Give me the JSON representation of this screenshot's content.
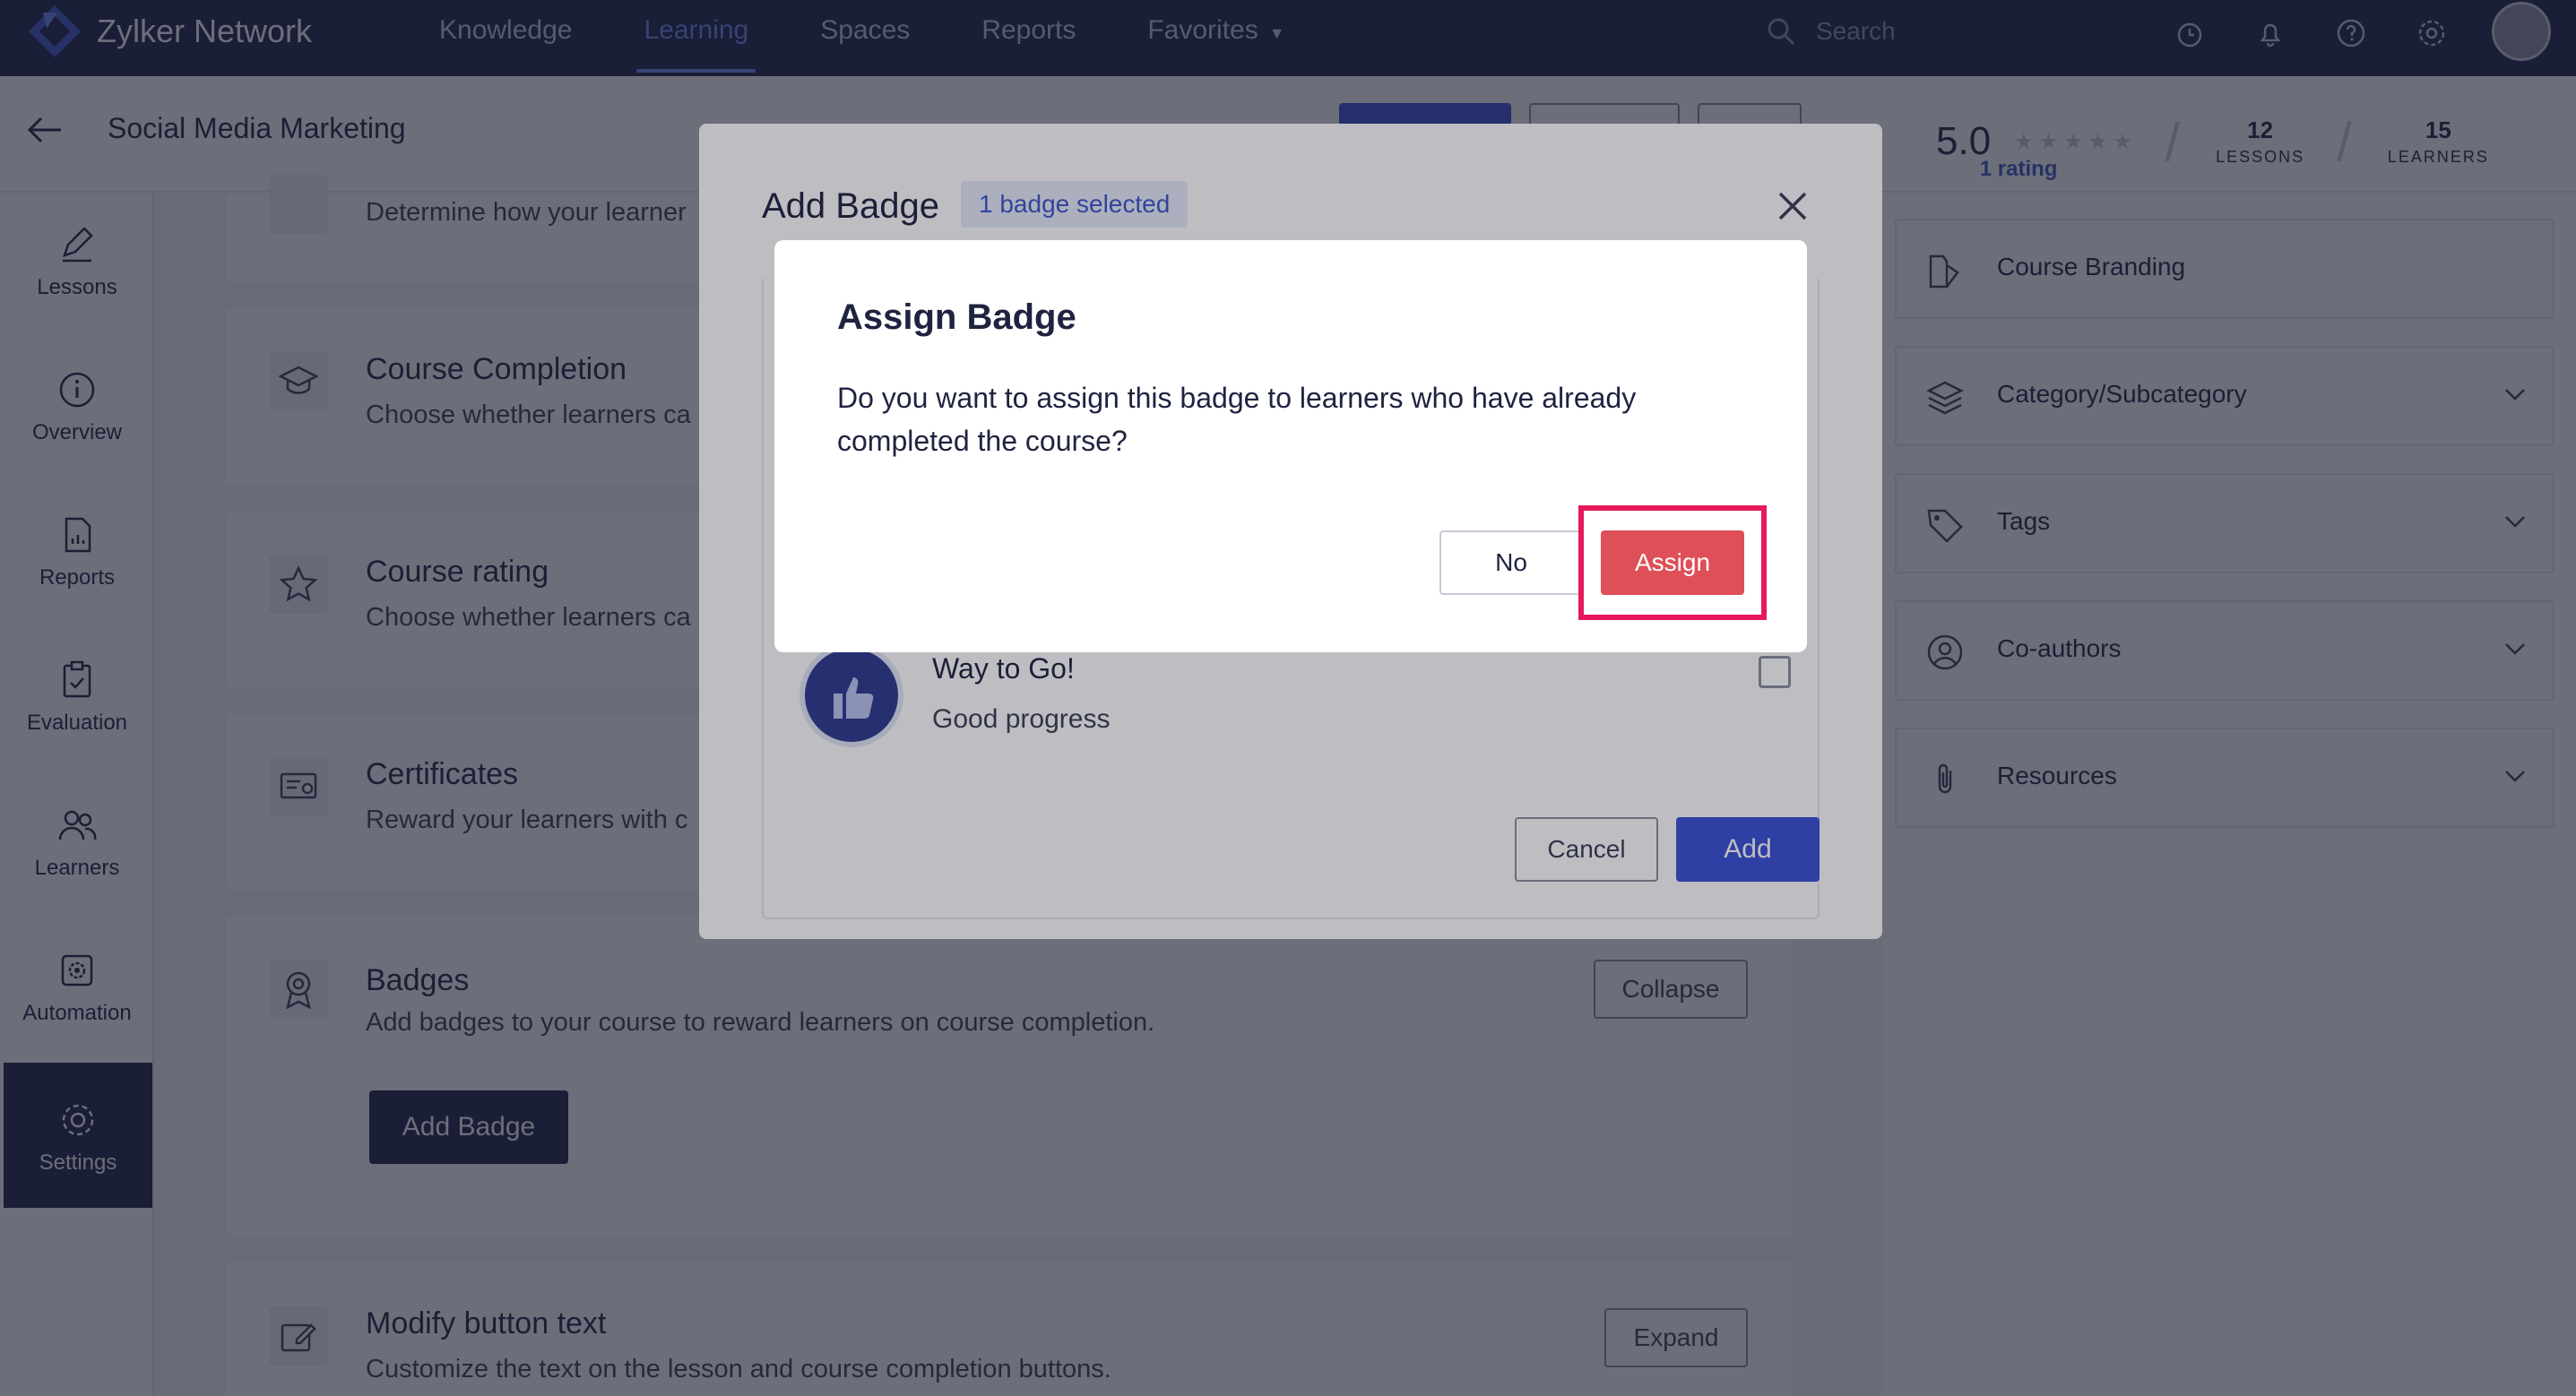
{
  "app": {
    "name": "Zylker Network"
  },
  "nav": {
    "links": [
      "Knowledge",
      "Learning",
      "Spaces",
      "Reports",
      "Favorites"
    ],
    "active": "Learning"
  },
  "search": {
    "placeholder": "Search"
  },
  "course": {
    "title": "Social Media Marketing",
    "rating_value": "5.0",
    "rating_count": "1 rating",
    "lessons_count": "12",
    "lessons_label": "LESSONS",
    "learners_count": "15",
    "learners_label": "LEARNERS"
  },
  "sidebar": {
    "items": [
      {
        "label": "Lessons",
        "icon": "pencil-icon"
      },
      {
        "label": "Overview",
        "icon": "info-icon"
      },
      {
        "label": "Reports",
        "icon": "report-icon"
      },
      {
        "label": "Evaluation",
        "icon": "clipboard-icon"
      },
      {
        "label": "Learners",
        "icon": "users-icon"
      },
      {
        "label": "Automation",
        "icon": "automation-icon"
      },
      {
        "label": "Settings",
        "icon": "gear-icon"
      }
    ],
    "active": "Settings"
  },
  "settings": {
    "top_partial": "Determine how your learner",
    "sections": [
      {
        "title": "Course Completion",
        "desc": "Choose whether learners ca",
        "icon": "graduation-cap-icon"
      },
      {
        "title": "Course rating",
        "desc": "Choose whether learners ca",
        "icon": "star-icon"
      },
      {
        "title": "Certificates",
        "desc": "Reward your learners with c",
        "icon": "certificate-icon"
      }
    ],
    "badges": {
      "title": "Badges",
      "desc": "Add badges to your course to reward learners on course completion.",
      "collapse_label": "Collapse",
      "add_badge_label": "Add Badge"
    },
    "modify_button": {
      "title": "Modify button text",
      "desc": "Customize the text on the lesson and course completion buttons.",
      "expand_label": "Expand"
    }
  },
  "right_panel": {
    "items": [
      {
        "label": "Course Branding",
        "icon": "branding-icon",
        "expandable": false
      },
      {
        "label": "Category/Subcategory",
        "icon": "layers-icon",
        "expandable": true
      },
      {
        "label": "Tags",
        "icon": "tag-icon",
        "expandable": true
      },
      {
        "label": "Co-authors",
        "icon": "user-circle-icon",
        "expandable": true
      },
      {
        "label": "Resources",
        "icon": "paperclip-icon",
        "expandable": true
      }
    ]
  },
  "add_badge_modal": {
    "title": "Add Badge",
    "selected_pill": "1 badge selected",
    "badge": {
      "name": "Way to Go!",
      "subtitle": "Good progress",
      "checked": false
    },
    "cancel_label": "Cancel",
    "add_label": "Add"
  },
  "assign_dialog": {
    "title": "Assign Badge",
    "message": "Do you want to assign this badge to learners who have already completed the course?",
    "no_label": "No",
    "assign_label": "Assign"
  },
  "colors": {
    "nav_bg": "#1c2145",
    "accent": "#3a4fd6",
    "assign_btn": "#df4f58",
    "highlight": "#e6195a"
  }
}
